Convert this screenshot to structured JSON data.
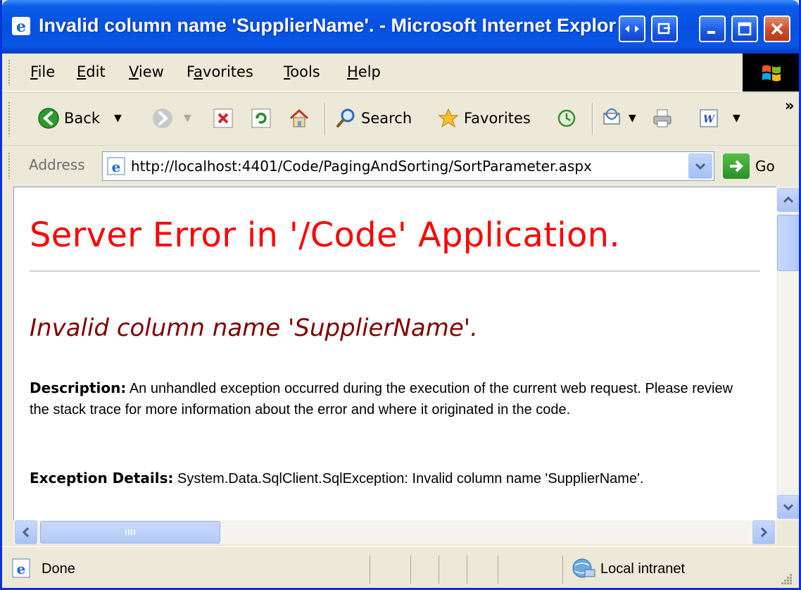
{
  "window": {
    "title": "Invalid column name 'SupplierName'. - Microsoft Internet Explorer"
  },
  "menu": {
    "items": [
      {
        "label": "File",
        "key": "F",
        "rest": "ile"
      },
      {
        "label": "Edit",
        "key": "E",
        "rest": "dit"
      },
      {
        "label": "View",
        "key": "V",
        "rest": "iew"
      },
      {
        "label": "Favorites",
        "key": "a",
        "pre": "F",
        "rest": "vorites"
      },
      {
        "label": "Tools",
        "key": "T",
        "rest": "ools"
      },
      {
        "label": "Help",
        "key": "H",
        "rest": "elp"
      }
    ]
  },
  "toolbar": {
    "back_label": "Back",
    "search_label": "Search",
    "favorites_label": "Favorites",
    "more": "»"
  },
  "address": {
    "label": "Address",
    "url": "http://localhost:4401/Code/PagingAndSorting/SortParameter.aspx",
    "go_label": "Go"
  },
  "page": {
    "error_title": "Server Error in '/Code' Application.",
    "error_message": "Invalid column name 'SupplierName'.",
    "description_label": "Description:",
    "description_text": " An unhandled exception occurred during the execution of the current web request. Please review the stack trace for more information about the error and where it originated in the code.",
    "exception_label": "Exception Details:",
    "exception_text": " System.Data.SqlClient.SqlException: Invalid column name 'SupplierName'."
  },
  "status": {
    "text": "Done",
    "zone": "Local intranet"
  },
  "colors": {
    "titlebar": "#0b5ce8",
    "error_title": "#ff0000",
    "error_message": "#800000"
  }
}
